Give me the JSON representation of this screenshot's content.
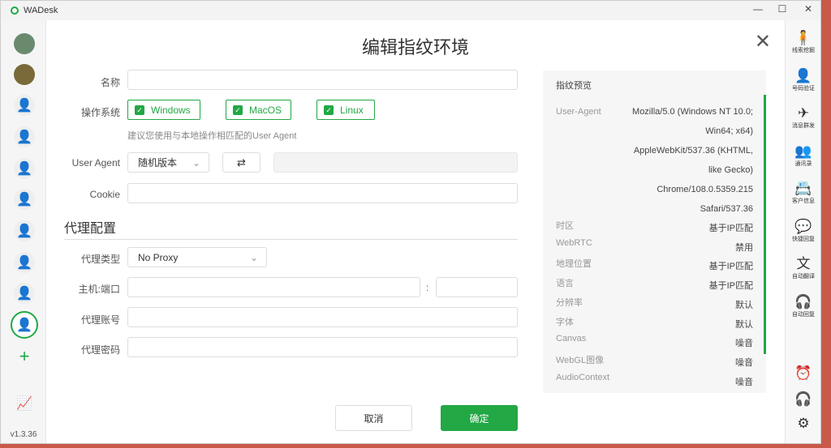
{
  "window": {
    "title": "WADesk",
    "version": "v1.3.36"
  },
  "dialog": {
    "title": "编辑指纹环境",
    "name_label": "名称",
    "os_label": "操作系统",
    "os_options": [
      {
        "label": "Windows",
        "checked": true
      },
      {
        "label": "MacOS",
        "checked": true
      },
      {
        "label": "Linux",
        "checked": true
      }
    ],
    "os_hint": "建议您使用与本地操作相匹配的User Agent",
    "ua_label": "User Agent",
    "ua_select": "随机版本",
    "cookie_label": "Cookie",
    "proxy_section": "代理配置",
    "proxy_type_label": "代理类型",
    "proxy_type": "No Proxy",
    "host_label": "主机:端口",
    "port_sep": ":",
    "account_label": "代理账号",
    "password_label": "代理密码",
    "cancel": "取消",
    "confirm": "确定"
  },
  "preview": {
    "title": "指纹预览",
    "user_agent_label": "User-Agent",
    "user_agent_lines": [
      "Mozilla/5.0 (Windows NT 10.0;",
      "Win64; x64)",
      "AppleWebKit/537.36 (KHTML,",
      "like Gecko)",
      "Chrome/108.0.5359.215",
      "Safari/537.36"
    ],
    "rows": [
      {
        "k": "时区",
        "v": "基于IP匹配"
      },
      {
        "k": "WebRTC",
        "v": "禁用"
      },
      {
        "k": "地理位置",
        "v": "基于IP匹配"
      },
      {
        "k": "语言",
        "v": "基于IP匹配"
      },
      {
        "k": "分辨率",
        "v": "默认"
      },
      {
        "k": "字体",
        "v": "默认"
      },
      {
        "k": "Canvas",
        "v": "噪音"
      },
      {
        "k": "WebGL图像",
        "v": "噪音"
      },
      {
        "k": "AudioContext",
        "v": "噪音"
      }
    ]
  },
  "right_sidebar": [
    "线索挖掘",
    "号码验证",
    "消息群发",
    "通讯录",
    "客户信息",
    "快捷回复",
    "自动翻译",
    "自动回复"
  ],
  "accent": "#22a845"
}
